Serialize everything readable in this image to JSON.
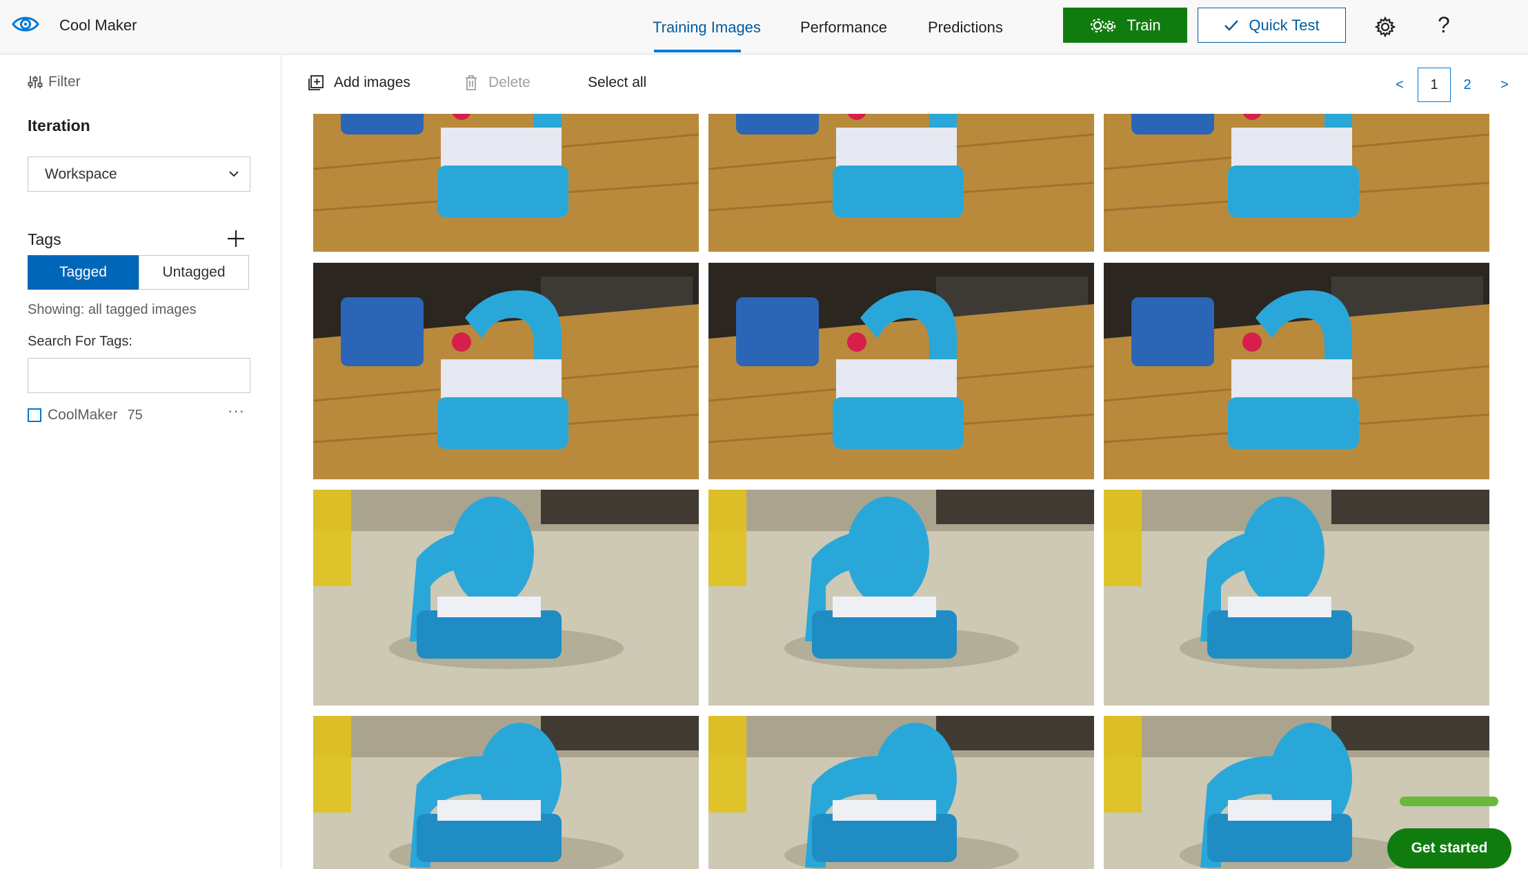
{
  "app": {
    "title": "Cool Maker",
    "logo_icon": "eye-icon"
  },
  "nav": {
    "tabs": [
      {
        "label": "Training Images",
        "active": true
      },
      {
        "label": "Performance",
        "active": false
      },
      {
        "label": "Predictions",
        "active": false
      }
    ]
  },
  "header_actions": {
    "train_label": "Train",
    "quick_test_label": "Quick Test",
    "settings_icon": "gear-icon",
    "help_glyph": "?"
  },
  "sidebar": {
    "filter_label": "Filter",
    "iteration_label": "Iteration",
    "iteration_selected": "Workspace",
    "tags_label": "Tags",
    "segments": {
      "tagged": "Tagged",
      "untagged": "Untagged",
      "selected": "Tagged"
    },
    "showing_text": "Showing: all tagged images",
    "search_label": "Search For Tags:",
    "search_value": "",
    "tags": [
      {
        "name": "CoolMaker",
        "count": "75",
        "checked": false,
        "more": "···"
      }
    ]
  },
  "toolbar": {
    "add_images": "Add images",
    "delete": "Delete",
    "select_all": "Select all"
  },
  "pagination": {
    "prev": "<",
    "pages": [
      "1",
      "2"
    ],
    "current": "1",
    "next": ">"
  },
  "images": {
    "description_note": "3x4 grid of training images of a blue toy sewing machine",
    "rows": 4,
    "cols": 3
  },
  "onboarding": {
    "get_started": "Get started"
  },
  "colors": {
    "accent": "#0078d4",
    "train_green": "#107c10",
    "segment_selected": "#0066b8",
    "toy_blue": "#2aa7d9"
  }
}
